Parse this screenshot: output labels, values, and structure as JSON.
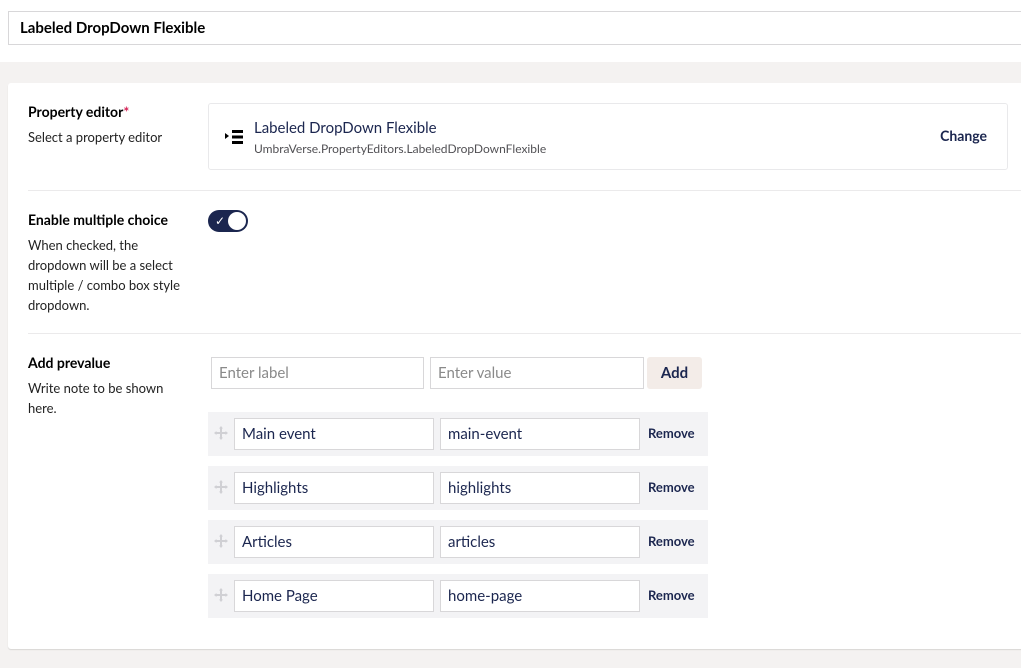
{
  "header": {
    "name": "Labeled DropDown Flexible"
  },
  "property_editor": {
    "label": "Property editor",
    "required_mark": "*",
    "description": "Select a property editor",
    "editor_name": "Labeled DropDown Flexible",
    "editor_alias": "UmbraVerse.PropertyEditors.LabeledDropDownFlexible",
    "change_label": "Change",
    "icon": "list-icon"
  },
  "multiple_choice": {
    "label": "Enable multiple choice",
    "description": "When checked, the dropdown will be a select multiple / combo box style dropdown.",
    "enabled": true
  },
  "prevalues": {
    "label": "Add prevalue",
    "description": "Write note to be shown here.",
    "label_placeholder": "Enter label",
    "value_placeholder": "Enter value",
    "add_label": "Add",
    "remove_label": "Remove",
    "items": [
      {
        "label": "Main event",
        "value": "main-event"
      },
      {
        "label": "Highlights",
        "value": "highlights"
      },
      {
        "label": "Articles",
        "value": "articles"
      },
      {
        "label": "Home Page",
        "value": "home-page"
      }
    ]
  },
  "colors": {
    "primary": "#1b264f",
    "required": "#d42054",
    "add_button_bg": "#f3ece8"
  }
}
